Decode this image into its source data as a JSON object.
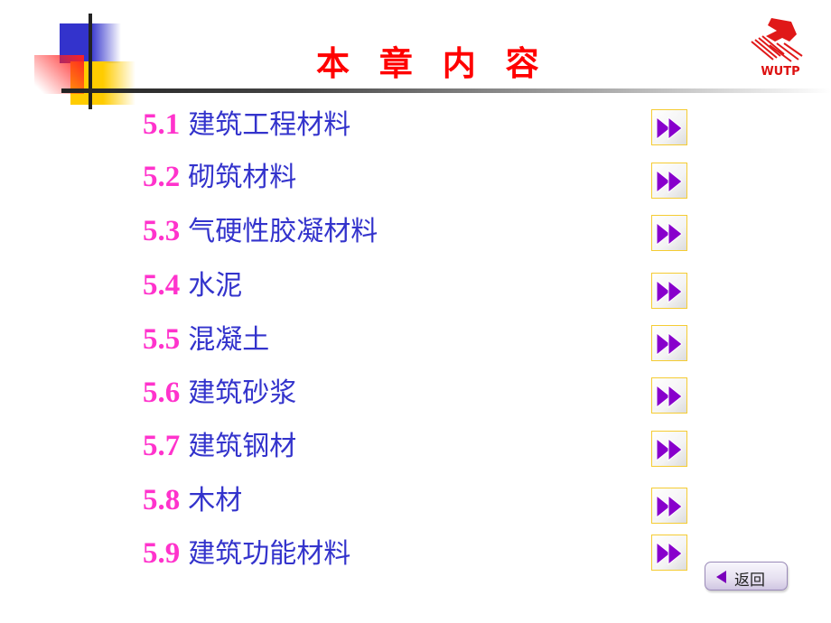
{
  "title": "本 章 内 容",
  "logo": {
    "text": "WUTP",
    "icon": "publisher-logo-icon"
  },
  "colors": {
    "title": "#ff0000",
    "number": "#ff33cc",
    "label": "#3333cc",
    "arrow": "#8800cc"
  },
  "items": [
    {
      "num": "5.1",
      "label": "建筑工程材料",
      "icon": "fast-forward-icon"
    },
    {
      "num": "5.2",
      "label": "砌筑材料",
      "icon": "fast-forward-icon"
    },
    {
      "num": "5.3",
      "label": "气硬性胶凝材料",
      "icon": "fast-forward-icon"
    },
    {
      "num": "5.4",
      "label": "水泥",
      "icon": "fast-forward-icon"
    },
    {
      "num": "5.5",
      "label": "混凝土",
      "icon": "fast-forward-icon"
    },
    {
      "num": "5.6",
      "label": "建筑砂浆",
      "icon": "fast-forward-icon"
    },
    {
      "num": "5.7",
      "label": "建筑钢材",
      "icon": "fast-forward-icon"
    },
    {
      "num": "5.8",
      "label": "木材",
      "icon": "fast-forward-icon"
    },
    {
      "num": "5.9",
      "label": "建筑功能材料",
      "icon": "fast-forward-icon"
    }
  ],
  "back_button": {
    "label": "返回",
    "icon": "back-arrow-icon"
  }
}
